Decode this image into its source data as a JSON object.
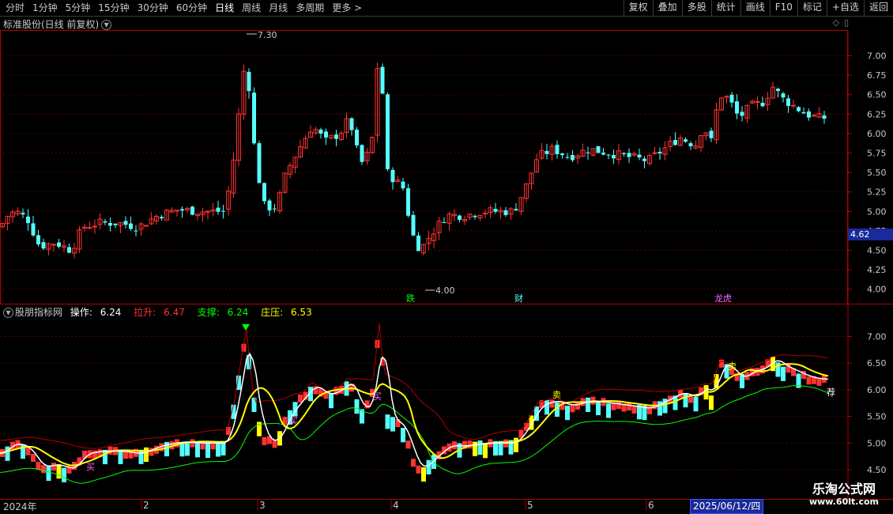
{
  "toolbar": {
    "periods": [
      "分时",
      "1分钟",
      "5分钟",
      "15分钟",
      "30分钟",
      "60分钟",
      "日线",
      "周线",
      "月线",
      "多周期",
      "更多 >"
    ],
    "active_period": "日线",
    "tools": [
      "复权",
      "叠加",
      "多股",
      "统计",
      "画线",
      "F10",
      "标记",
      "+自选",
      "返回"
    ]
  },
  "main_chart": {
    "title": "标准股份(日线 前复权)",
    "price_axis": [
      "7.00",
      "6.75",
      "6.50",
      "6.25",
      "6.00",
      "5.75",
      "5.50",
      "5.25",
      "5.00",
      "4.75",
      "4.50",
      "4.25",
      "4.00"
    ],
    "high_label": "7.30",
    "low_label": "4.00",
    "current_price_flag": "4.62",
    "markers": [
      "跌",
      "财",
      "龙虎"
    ]
  },
  "indicator_panel": {
    "name": "股朋指标网",
    "op_label": "操作:",
    "op_value": "6.24",
    "pull_label": "拉升:",
    "pull_value": "6.47",
    "support_label": "支撑:",
    "support_value": "6.24",
    "press_label": "庄压:",
    "press_value": "6.53",
    "axis": [
      "7.00",
      "6.50",
      "6.00",
      "5.50",
      "5.00",
      "4.50"
    ],
    "signal_labels": [
      "买",
      "荐",
      "买",
      "买",
      "卖",
      "卖"
    ]
  },
  "date_axis": {
    "labels": [
      "2024年",
      "2",
      "3",
      "4",
      "5",
      "6"
    ],
    "cursor_date": "2025/06/12/四"
  },
  "watermark": {
    "line1": "乐淘公式网",
    "line2": "www.60lt.com"
  },
  "colors": {
    "up": "#ff3232",
    "down": "#54ffff",
    "yellow": "#ffff00",
    "green": "#00ff00",
    "white": "#ffffff",
    "dark_red": "#b00000"
  }
}
